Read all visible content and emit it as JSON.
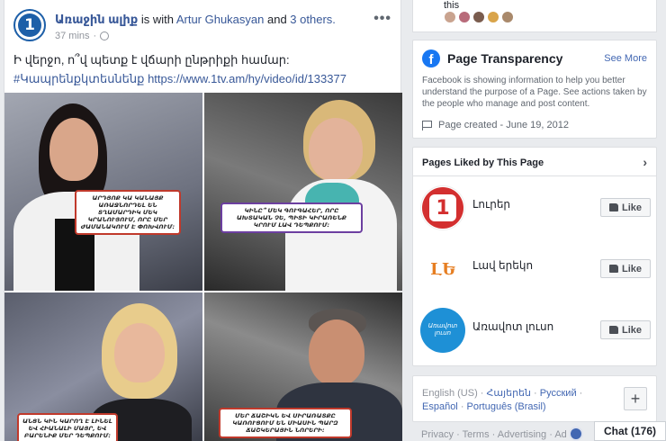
{
  "post": {
    "page_name": "Առաջին ալիք",
    "with_text": " is with ",
    "tagged_person": "Artur Ghukasyan",
    "and_text": " and ",
    "others": "3 others.",
    "time": "37 mins",
    "more_label": "•••",
    "text_line1": "Ի վերջո, ո՞վ պետք է վճարի ընթրիքի համար:",
    "hashtag": "#Կապրենքկտեսնենք",
    "url": "https://www.1tv.am/hy/video/id/133377",
    "avatar_label": "1"
  },
  "sidebar": {
    "top_text": "this",
    "avatar_colors": [
      "#c9a38f",
      "#b86b7a",
      "#7a5c4e",
      "#d9a44a",
      "#a9896b"
    ],
    "transparency": {
      "title": "Page Transparency",
      "see_more": "See More",
      "description": "Facebook is showing information to help you better understand the purpose of a Page. See actions taken by the people who manage and post content.",
      "created": "Page created - June 19, 2012",
      "logo_letter": "f"
    },
    "liked": {
      "title": "Pages Liked by This Page",
      "chevron": "›",
      "pages": [
        {
          "name": "Լուրեր",
          "like": "Like",
          "logo_text": "1",
          "logo_color": "#d32f2f"
        },
        {
          "name": "Լավ երեկո",
          "like": "Like",
          "logo_text": "ԼԵ",
          "logo_color": "#e67e22"
        },
        {
          "name": "Առավոտ լուսո",
          "like": "Like",
          "logo_text": "Առավոտ լուսո",
          "logo_color": "#1e90d6"
        }
      ]
    },
    "languages": {
      "current": "English (US)",
      "others": [
        "Հայերեն",
        "Русский",
        "Español",
        "Português (Brasil)"
      ],
      "plus": "+"
    },
    "footer": "Privacy · Terms · Advertising · Ad",
    "chat": "Chat (176)"
  },
  "bubbles": [
    "ԱՐԴՅՈՔ ԿԱ ԿԱՆԱՅՔ ԱՌԱՋՆՈՐԴԵԼ ԵՆ ՏՂԱՄԱՐԴԻԿ ՄԵԿ ԿՐԱՆՈՒՅՈՒՄ, ՈՐԸ ՄԵՐ ԺԱՄԱՆԱԿՈՒՄ Է ՓՈԽՎՈՒՄ:",
    "ԿԻՆԸ՞ ՄԵԿ ԳՈՒԳԱՀԵՐ, ՈՐԸ ԱԽՏԱԿԱՆ ՉԵ, ՊԻՏԻ ԿԻՐԱՌԵՆՔ ԿՐՈՒՄ ԼԱՎ ԴԵՊՔՈՒՄ:",
    "ՄԵՐ ՃԱՇԻԿՆ ԵՎ ՍԻՐԱՌԱՏՔԸ ԿԱՌՈՒՑՈՒՄ ԵՆ ՄԻԱՍԻՆ ՊԱՐԶ ՃԱՇԿԵՐԱՅԻՆ ՆՈՐԵՐԻ:",
    "ԱՆՑՆ ԿԻՆ ԿԱՐՈՂ Է ԼԻՆԵԼ ԵՎ ՀԻԱՆԱԼԻ ՄԱՅՐ, ԵՎ ԲԱՐԵՆԻՔ ՄԵՐ ԴԵՊՔՈՒՄ:"
  ]
}
